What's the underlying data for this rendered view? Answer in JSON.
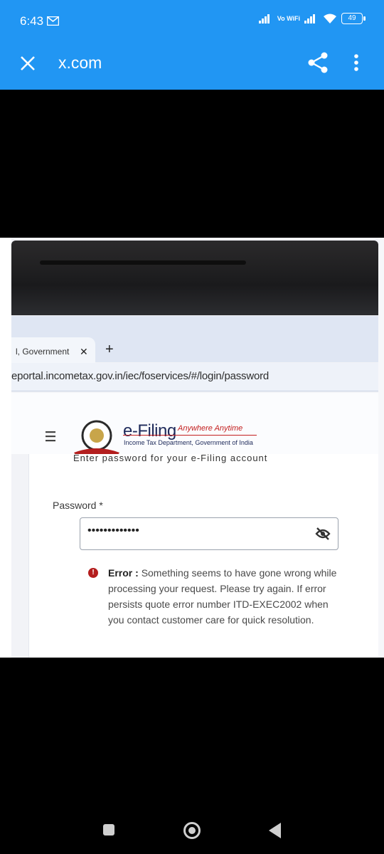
{
  "status": {
    "time": "6:43",
    "network": "Vo WiFi",
    "battery": "49"
  },
  "appbar": {
    "title": "x.com"
  },
  "photo": {
    "tab_label": "l, Government",
    "tab_close": "✕",
    "new_tab": "+",
    "url": "eportal.incometax.gov.in/iec/foservices/#/login/password",
    "brand": "e-Filing",
    "tagline": "Anywhere Anytime",
    "department": "Income Tax Department, Government of India",
    "cut_text": "Enter password for your e-Filing account",
    "password_label": "Password *",
    "password_value": "•••••••••••••",
    "error_label": "Error :",
    "error_message": "Something seems to have gone wrong while processing your request. Please try again. If error persists quote error number ITD-EXEC2002 when you contact customer care for quick resolution."
  },
  "colors": {
    "appbar": "#2196f3",
    "error": "#b41d1d",
    "brand": "#1e2a5a"
  }
}
